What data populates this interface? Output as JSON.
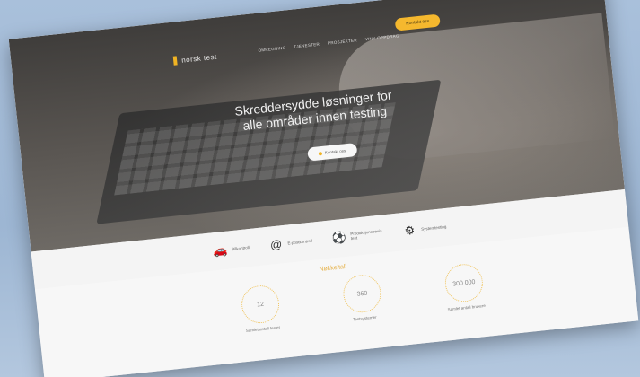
{
  "nav": {
    "logo_text": "norsk test",
    "menu": [
      "Omregning",
      "Tjenester",
      "Prosjekter",
      "Vinn oppdrag"
    ],
    "cta": "Kontakt oss"
  },
  "hero": {
    "headline": "Skreddersydde løsninger for alle områder innen testing",
    "button_label": "Kontakt oss"
  },
  "services": [
    {
      "icon": "car-icon",
      "glyph": "🚗",
      "label": "Bilkontroll"
    },
    {
      "icon": "at-icon",
      "glyph": "@",
      "label": "E-postkontroll"
    },
    {
      "icon": "soccer-ball-icon",
      "glyph": "⚽",
      "label": "Produksjonsbevis test"
    },
    {
      "icon": "gear-icon",
      "glyph": "⚙",
      "label": "Systemtesting"
    }
  ],
  "stats": {
    "title": "Nøkkeltall",
    "items": [
      {
        "value": "12",
        "caption": "Samlet antall tester"
      },
      {
        "value": "360",
        "caption": "Testsystemer"
      },
      {
        "value": "300 000",
        "caption": "Samlet antall brukere"
      }
    ]
  },
  "colors": {
    "accent": "#f5b82e",
    "hero_dark": "#3f3d3b",
    "background": "#9db6d3"
  }
}
